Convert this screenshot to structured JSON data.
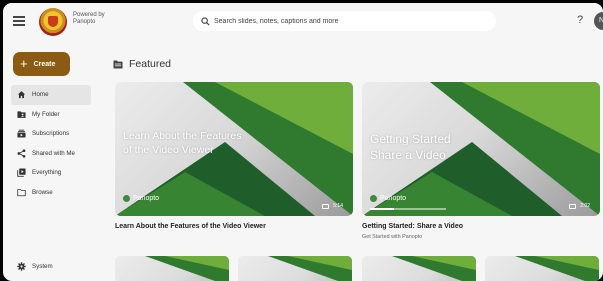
{
  "header": {
    "powered_line1": "Powered by",
    "powered_line2": "Panopto",
    "search_placeholder": "Search slides, notes, captions and more",
    "help_label": "?",
    "avatar_initial": "N"
  },
  "sidebar": {
    "create_label": "Create",
    "items": [
      {
        "label": "Home",
        "icon": "home-icon",
        "active": true
      },
      {
        "label": "My Folder",
        "icon": "folder-user-icon"
      },
      {
        "label": "Subscriptions",
        "icon": "subscriptions-icon"
      },
      {
        "label": "Shared with Me",
        "icon": "share-icon"
      },
      {
        "label": "Everything",
        "icon": "video-library-icon"
      },
      {
        "label": "Browse",
        "icon": "folder-icon"
      }
    ],
    "system_label": "System"
  },
  "main": {
    "section_title": "Featured",
    "cards": [
      {
        "thumb_title_line1": "Learn About the Features",
        "thumb_title_line2": "of the Video Viewer",
        "brand": "Panopto",
        "duration": "5:14",
        "title": "Learn About the Features of the Video Viewer",
        "subtitle": ""
      },
      {
        "thumb_title_line1": "Getting Started",
        "thumb_title_line2": "Share a Video",
        "brand": "Panopto",
        "duration": "2:02",
        "progress": 0.32,
        "title": "Getting Started: Share a Video",
        "subtitle": "Get Started with Panopto"
      }
    ]
  },
  "colors": {
    "accent": "#8b5a13",
    "panopto_green": "#2e7d32",
    "background": "#f6f6f6"
  }
}
